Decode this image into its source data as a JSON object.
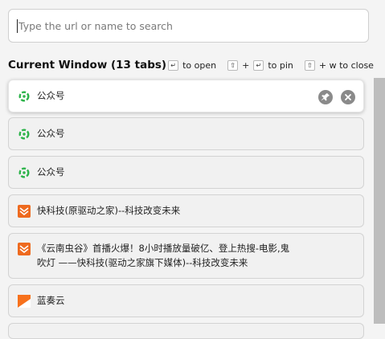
{
  "search": {
    "placeholder": "Type the url or name to search",
    "value": ""
  },
  "header": {
    "title": "Current Window (13 tabs)",
    "enter_key": "↵",
    "open_hint": "to open",
    "shift_key": "⇧",
    "plus": "+",
    "pin_hint": "to pin",
    "close_hint": "+ w to close"
  },
  "tabs": [
    {
      "title": "公众号",
      "icon": "wechat-icon",
      "active": true
    },
    {
      "title": "公众号",
      "icon": "wechat-icon",
      "active": false
    },
    {
      "title": "公众号",
      "icon": "wechat-icon",
      "active": false
    },
    {
      "title": "快科技(原驱动之家)--科技改变未来",
      "icon": "mydrivers-icon",
      "active": false
    },
    {
      "title_line1": "《云南虫谷》首播火爆！8小时播放量破亿、登上热搜-电影,鬼",
      "title_line2": "吹灯 ——快科技(驱动之家旗下媒体)--科技改变未来",
      "icon": "mydrivers-icon",
      "active": false
    },
    {
      "title": "蓝奏云",
      "icon": "lanzou-icon",
      "active": false
    }
  ],
  "colors": {
    "wechat": "#2cb34a",
    "mydrivers": "#ee6a1f",
    "lanzou": "#f7711c",
    "scrollbar": "#bdbdbd"
  }
}
